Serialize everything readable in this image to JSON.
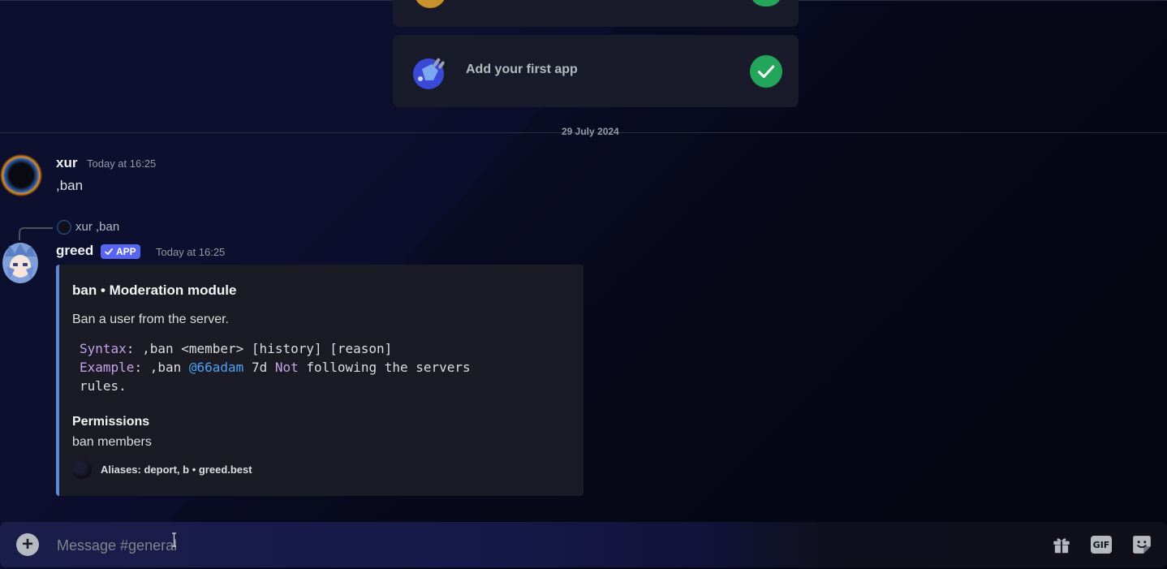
{
  "onboarding": {
    "add_app_label": "Add your first app"
  },
  "divider": {
    "date": "29 July 2024"
  },
  "messages": [
    {
      "author": "xur",
      "timestamp": "Today at 16:25",
      "content": ",ban"
    },
    {
      "author": "greed",
      "badge": "APP",
      "timestamp": "Today at 16:25",
      "reply": {
        "author": "xur",
        "content": ",ban"
      },
      "embed": {
        "accent_color": "#5e88d9",
        "title": "ban • Moderation module",
        "description": "Ban a user from the server.",
        "syntax_key": "Syntax",
        "syntax_value": ": ,ban <member> [history] [reason]",
        "example_key": "Example",
        "example_pre": ": ,ban ",
        "example_mention": "@66adam",
        "example_mid": " 7d ",
        "example_kw": "Not",
        "example_post": " following the servers",
        "example_wrap": "rules.",
        "field_name": "Permissions",
        "field_value": "ban members",
        "footer": "Aliases: deport, b • greed.best"
      }
    }
  ],
  "composer": {
    "placeholder": "Message #general",
    "icons": [
      "add-icon",
      "gift-icon",
      "gif-icon",
      "sticker-icon"
    ],
    "gif_label": "GIF"
  },
  "colors": {
    "accent": "#5865f2",
    "success": "#23a55a",
    "mention": "#4ea0f5",
    "keyword": "#c5a2ec"
  }
}
